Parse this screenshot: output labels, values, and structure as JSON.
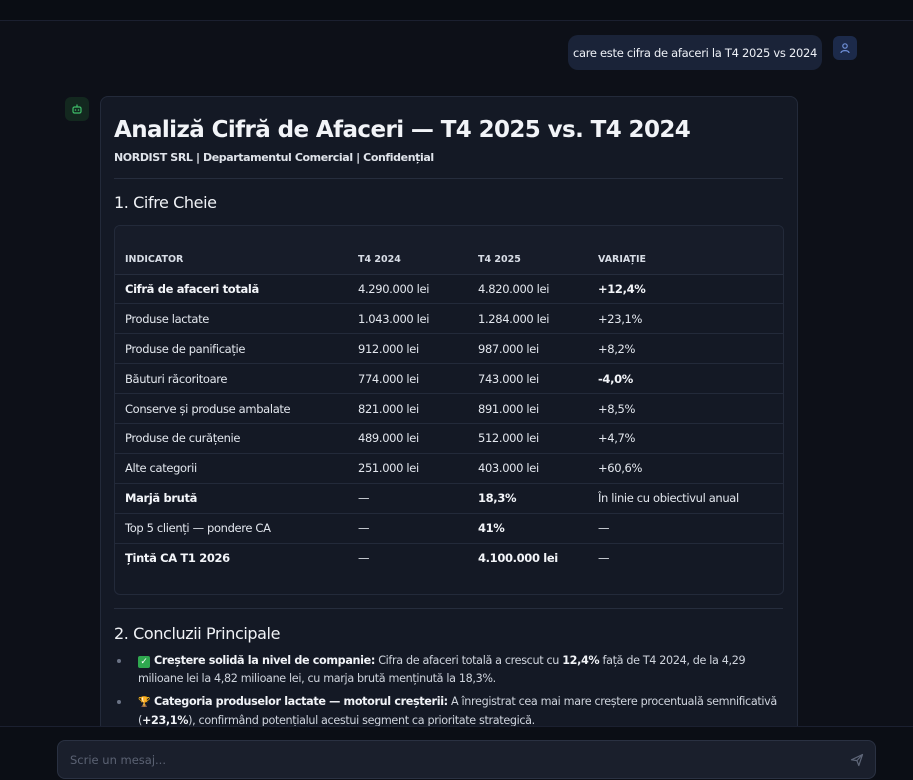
{
  "user_message": "care este cifra de afaceri la T4 2025 vs 2024",
  "report": {
    "title": "Analiză Cifră de Afaceri — T4 2025 vs. T4 2024",
    "subtitle": "NORDIST SRL | Departamentul Comercial | Confidențial",
    "section1_title": "1. Cifre Cheie",
    "table": {
      "headers": [
        "INDICATOR",
        "T4 2024",
        "T4 2025",
        "VARIAȚIE"
      ],
      "rows": [
        {
          "cells": [
            "Cifră de afaceri totală",
            "4.290.000 lei",
            "4.820.000 lei",
            "+12,4%"
          ]
        },
        {
          "cells": [
            "Produse lactate",
            "1.043.000 lei",
            "1.284.000 lei",
            "+23,1%"
          ]
        },
        {
          "cells": [
            "Produse de panificație",
            "912.000 lei",
            "987.000 lei",
            "+8,2%"
          ]
        },
        {
          "cells": [
            "Băuturi răcoritoare",
            "774.000 lei",
            "743.000 lei",
            "-4,0%"
          ]
        },
        {
          "cells": [
            "Conserve și produse ambalate",
            "821.000 lei",
            "891.000 lei",
            "+8,5%"
          ]
        },
        {
          "cells": [
            "Produse de curățenie",
            "489.000 lei",
            "512.000 lei",
            "+4,7%"
          ]
        },
        {
          "cells": [
            "Alte categorii",
            "251.000 lei",
            "403.000 lei",
            "+60,6%"
          ]
        },
        {
          "cells": [
            "Marjă brută",
            "—",
            "18,3%",
            "În linie cu obiectivul anual"
          ]
        },
        {
          "cells": [
            "Top 5 clienți — pondere CA",
            "—",
            "41%",
            "—"
          ]
        },
        {
          "cells": [
            "Țintă CA T1 2026",
            "—",
            "4.100.000 lei",
            "—"
          ]
        }
      ]
    },
    "section2_title": "2. Concluzii Principale",
    "conclusions": [
      {
        "icon": "check-icon",
        "lead": "Creștere solidă la nivel de companie:",
        "t1": " Cifra de afaceri totală a crescut cu ",
        "b1": "12,4%",
        "t2": " față de T4 2024, de la 4,29 milioane lei la 4,82 milioane lei, cu marja brută menținută la 18,3%."
      },
      {
        "icon": "trophy-icon",
        "lead": "Categoria produselor lactate — motorul creșterii:",
        "t1": " A înregistrat cea mai mare creștere procentuală semnificativă (",
        "b1": "+23,1%",
        "t2": "), confirmând potențialul acestui segment ca prioritate strategică."
      }
    ]
  },
  "composer": {
    "placeholder": "Scrie un mesaj..."
  },
  "colors": {
    "background": "#0d1018",
    "card": "#141925",
    "user_bubble": "#1a2338",
    "accent_blue": "#6f8fd8",
    "accent_green": "#3fbf6a"
  }
}
